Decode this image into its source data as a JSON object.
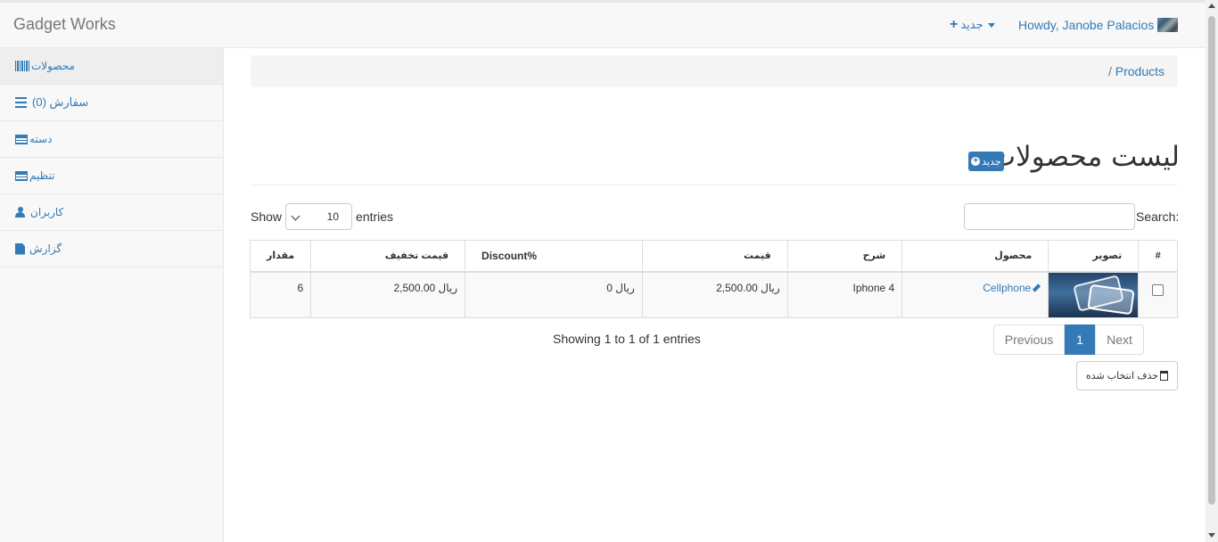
{
  "topbar": {
    "brand": "Gadget Works",
    "new_menu_label": "جدید",
    "user_greeting": "Howdy, Janobe Palacios"
  },
  "sidebar": {
    "items": [
      {
        "label": "محصولات",
        "icon": "barcode-icon"
      },
      {
        "label": "سفارش (0)",
        "icon": "list-icon"
      },
      {
        "label": "دسته",
        "icon": "table-icon"
      },
      {
        "label": "تنظیم",
        "icon": "table-icon"
      },
      {
        "label": "کاربران",
        "icon": "user-icon"
      },
      {
        "label": "گزارش",
        "icon": "file-icon"
      }
    ]
  },
  "breadcrumb": {
    "separator": "/",
    "current": "Products"
  },
  "page": {
    "title": "لیست محصولات",
    "new_badge_label": "جدید"
  },
  "controls": {
    "show_label": "Show",
    "page_size": "10",
    "entries_label": "entries",
    "search_label": "Search:",
    "search_value": ""
  },
  "table": {
    "headers": {
      "check": "#",
      "image": "تصویر",
      "product": "محصول",
      "description": "شرح",
      "price": "قیمت",
      "discount": "Discount%",
      "discounted_price": "قیمت تخفیف",
      "quantity": "مقدار"
    },
    "rows": [
      {
        "product": "Cellphone",
        "description": "Iphone 4",
        "price": "ریال 2,500.00",
        "discount": "ریال 0",
        "discounted_price": "ریال 2,500.00",
        "quantity": "6"
      }
    ]
  },
  "footer": {
    "info": "Showing 1 to 1 of 1 entries",
    "previous": "Previous",
    "current_page": "1",
    "next": "Next",
    "delete_label": "حذف انتخاب شده"
  },
  "colors": {
    "link": "#337ab7",
    "nav_bg": "#f8f8f8"
  }
}
